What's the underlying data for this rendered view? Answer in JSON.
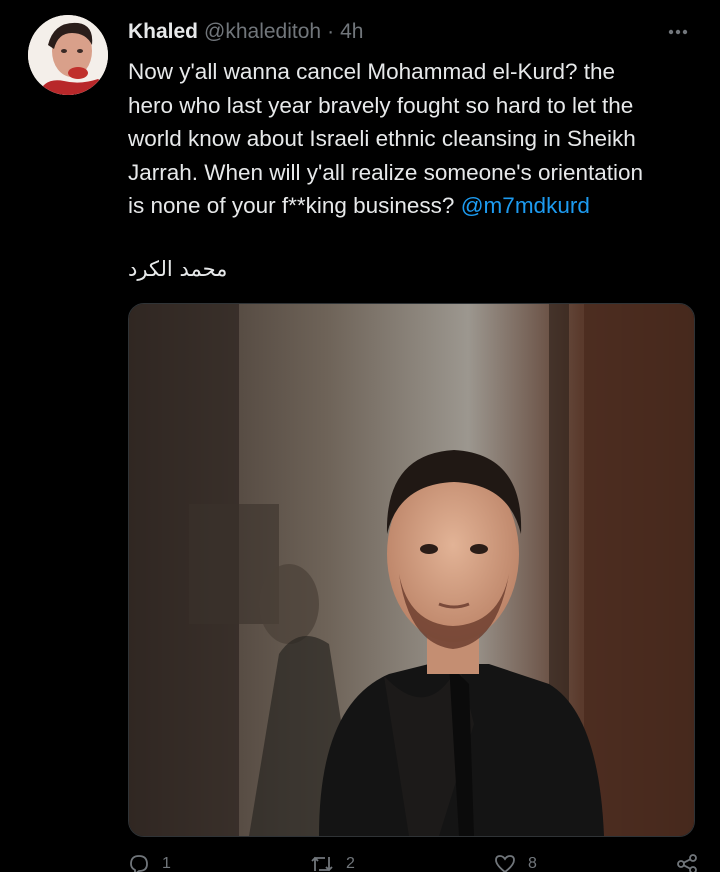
{
  "tweet": {
    "name": "Khaled",
    "handle": "@khaleditoh",
    "separator": "·",
    "time": "4h",
    "text_lines": [
      "Now y'all wanna cancel Mohammad el-Kurd? the",
      "hero who last year bravely fought so hard to let the",
      "world know about Israeli ethnic cleansing in Sheikh",
      "Jarrah. When will y'all realize someone's orientation",
      "is none of your f**king business?"
    ],
    "mention": "@m7mdkurd",
    "arabic": "محمد الكرد"
  },
  "actions": {
    "reply_count": "1",
    "retweet_count": "2",
    "like_count": "8"
  },
  "icons": {
    "more": "more-dots-icon",
    "reply": "reply-icon",
    "retweet": "retweet-icon",
    "like": "heart-icon",
    "share": "share-icon"
  },
  "colors": {
    "background": "#000000",
    "text": "#e7e9ea",
    "secondary": "#71767b",
    "link": "#1d9bf0"
  }
}
